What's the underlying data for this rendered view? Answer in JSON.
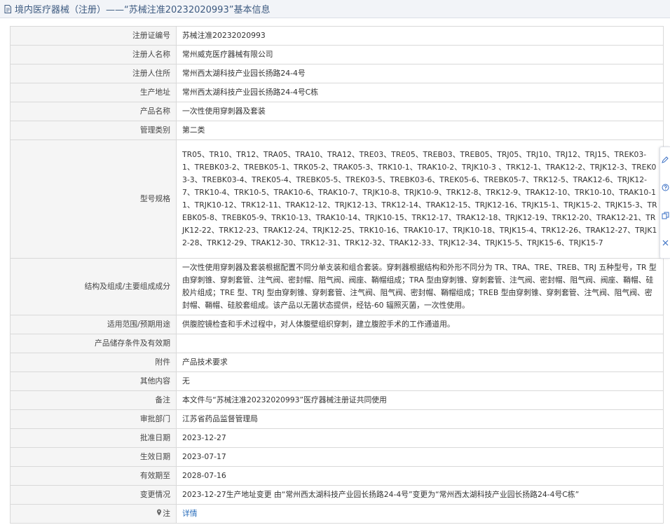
{
  "header": {
    "title": "境内医疗器械（注册）——“苏械注准20232020993”基本信息"
  },
  "rows": [
    {
      "label": "注册证编号",
      "value": "苏械注准20232020993"
    },
    {
      "label": "注册人名称",
      "value": "常州威克医疗器械有限公司"
    },
    {
      "label": "注册人住所",
      "value": "常州西太湖科技产业园长扬路24-4号"
    },
    {
      "label": "生产地址",
      "value": "常州西太湖科技产业园长扬路24-4号C栋"
    },
    {
      "label": "产品名称",
      "value": "一次性使用穿刺器及套装"
    },
    {
      "label": "管理类别",
      "value": "第二类"
    },
    {
      "label": "型号规格",
      "value": "TR05、TR10、TR12、TRA05、TRA10、TRA12、TRE03、TRE05、TREB03、TREB05、TRJ05、TRJ10、TRJ12、TRJ15、TREK03-1、TREBK03-2、TREBK05-1、TRK05-2、TRAK05-3、TRK10-1、TRAK10-2、TRJK10-3 、TRK12-1、TRAK12-2、TRJK12-3、TREK03-3、TREBK03-4、TREK05-4、TREBK05-5、TREK03-5、TREBK03-6、TREK05-6、TREBK05-7、TRK12-5、TRAK12-6、TRJK12-7、TRK10-4、TRK10-5、TRAK10-6、TRAK10-7、TRJK10-8、TRJK10-9、TRK12-8、TRK12-9、TRAK12-10、TRK10-10、TRAK10-11、TRJK10-12、TRK12-11、TRAK12-12、TRJK12-13、TRK12-14、TRAK12-15、TRJK12-16、TRJK15-1、TRJK15-2、TRJK15-3、TREBK05-8、TREBK05-9、TRK10-13、TRAK10-14、TRJK10-15、TRK12-17、TRAK12-18、TRJK12-19、TRK12-20、TRAK12-21、TRJK12-22、TRK12-23、TRAK12-24、TRJK12-25、TRK10-16、TRAK10-17、TRJK10-18、TRJK15-4、TRK12-26、TRAK12-27、TRJK12-28、TRK12-29、TRAK12-30、TRK12-31、TRK12-32、TRAK12-33、TRJK12-34、TRJK15-5、TRJK15-6、TRJK15-7"
    },
    {
      "label": "结构及组成/主要组成成分",
      "value": "一次性使用穿刺器及套装根据配置不同分单支装和组合套装。穿刺器根据结构和外形不同分为 TR、TRA、TRE、TREB、TRJ 五种型号，TR 型由穿刺锥、穿刺套管、注气阀、密封帽、阻气阀、阀座、鞘帽组成；TRA 型由穿刺锥、穿刺套管、注气阀、密封帽、阻气阀、阀座、鞘帽、硅胶片组成；TRE 型、TRJ 型由穿刺锥、穿刺套管、注气阀、阻气阀、密封帽、鞘帽组成；TREB 型由穿刺锥、穿刺套管、注气阀、阻气阀、密封帽、鞘帽、硅胶套组成。该产品以无菌状态提供，经钴-60 辐照灭菌，一次性使用。"
    },
    {
      "label": "适用范围/预期用途",
      "value": "供腹腔镜检查和手术过程中，对人体腹壁组织穿刺，建立腹腔手术的工作通道用。"
    },
    {
      "label": "产品储存条件及有效期",
      "value": ""
    },
    {
      "label": "附件",
      "value": "产品技术要求"
    },
    {
      "label": "其他内容",
      "value": "无"
    },
    {
      "label": "备注",
      "value": "本文件与“苏械注准20232020993”医疗器械注册证共同使用"
    },
    {
      "label": "审批部门",
      "value": "江苏省药品监督管理局"
    },
    {
      "label": "批准日期",
      "value": "2023-12-27"
    },
    {
      "label": "生效日期",
      "value": "2023-07-17"
    },
    {
      "label": "有效期至",
      "value": "2028-07-16"
    },
    {
      "label": "变更情况",
      "value": "2023-12-27生产地址变更 由“常州西太湖科技产业园长扬路24-4号”变更为“常州西太湖科技产业园长扬路24-4号C栋”"
    },
    {
      "label": "注",
      "value": "详情"
    }
  ],
  "icons": {
    "title_icon": "document-icon",
    "note_icon": "location-pin-icon",
    "sidebar": [
      "edit-icon",
      "help-icon",
      "copy-icon",
      "close-icon"
    ]
  },
  "colors": {
    "title_text": "#3d5a80",
    "link": "#2a6ebb",
    "label_bg": "#f5f5f5",
    "border": "#d9d9d9"
  }
}
